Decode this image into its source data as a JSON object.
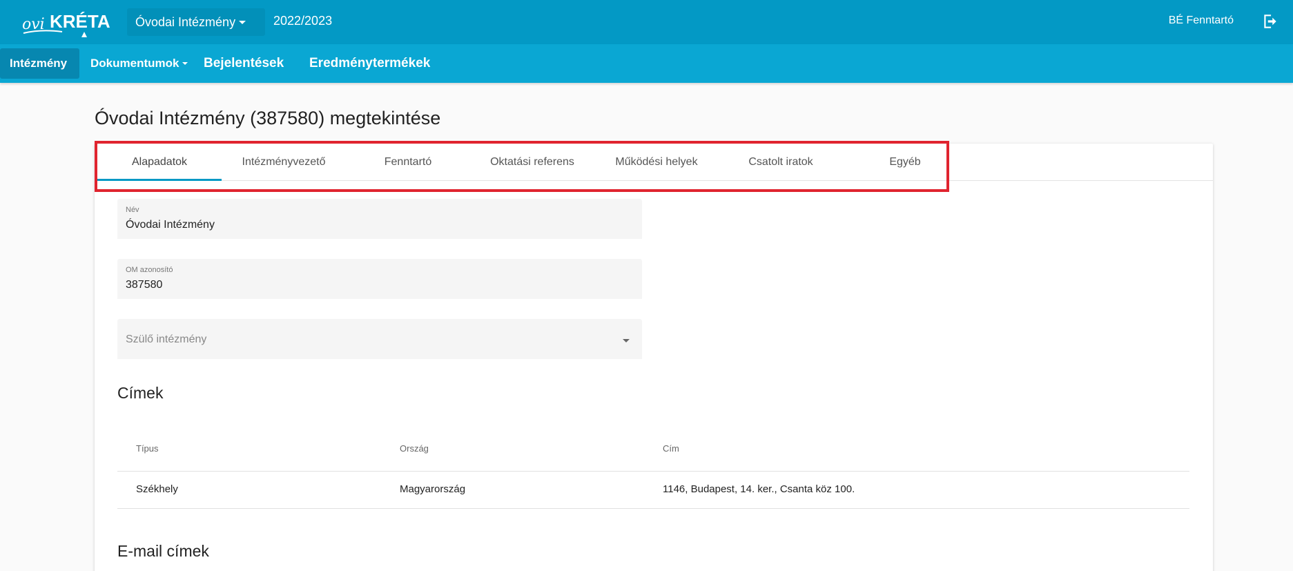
{
  "header": {
    "logo_text": "oviKRÉTA",
    "institution_select": "Óvodai Intézmény",
    "year": "2022/2023",
    "user": "BÉ Fenntartó"
  },
  "nav": {
    "items": [
      {
        "label": "Intézmény"
      },
      {
        "label": "Dokumentumok"
      },
      {
        "label": "Bejelentések"
      },
      {
        "label": "Eredménytermékek"
      }
    ]
  },
  "page": {
    "title": "Óvodai Intézmény (387580) megtekintése"
  },
  "tabs": [
    {
      "label": "Alapadatok"
    },
    {
      "label": "Intézményvezető"
    },
    {
      "label": "Fenntartó"
    },
    {
      "label": "Oktatási referens"
    },
    {
      "label": "Működési helyek"
    },
    {
      "label": "Csatolt iratok"
    },
    {
      "label": "Egyéb"
    }
  ],
  "form": {
    "name_label": "Név",
    "name_value": "Óvodai Intézmény",
    "om_label": "OM azonosító",
    "om_value": "387580",
    "parent_placeholder": "Szülő intézmény"
  },
  "addresses": {
    "title": "Címek",
    "columns": [
      "Típus",
      "Ország",
      "Cím"
    ],
    "rows": [
      [
        "Székhely",
        "Magyarország",
        "1146, Budapest, 14. ker., Csanta köz 100."
      ]
    ]
  },
  "emails": {
    "title": "E-mail címek"
  },
  "colors": {
    "topbar": "#0399c5",
    "navbar": "#0aa7d3",
    "highlight": "#e0242f"
  }
}
